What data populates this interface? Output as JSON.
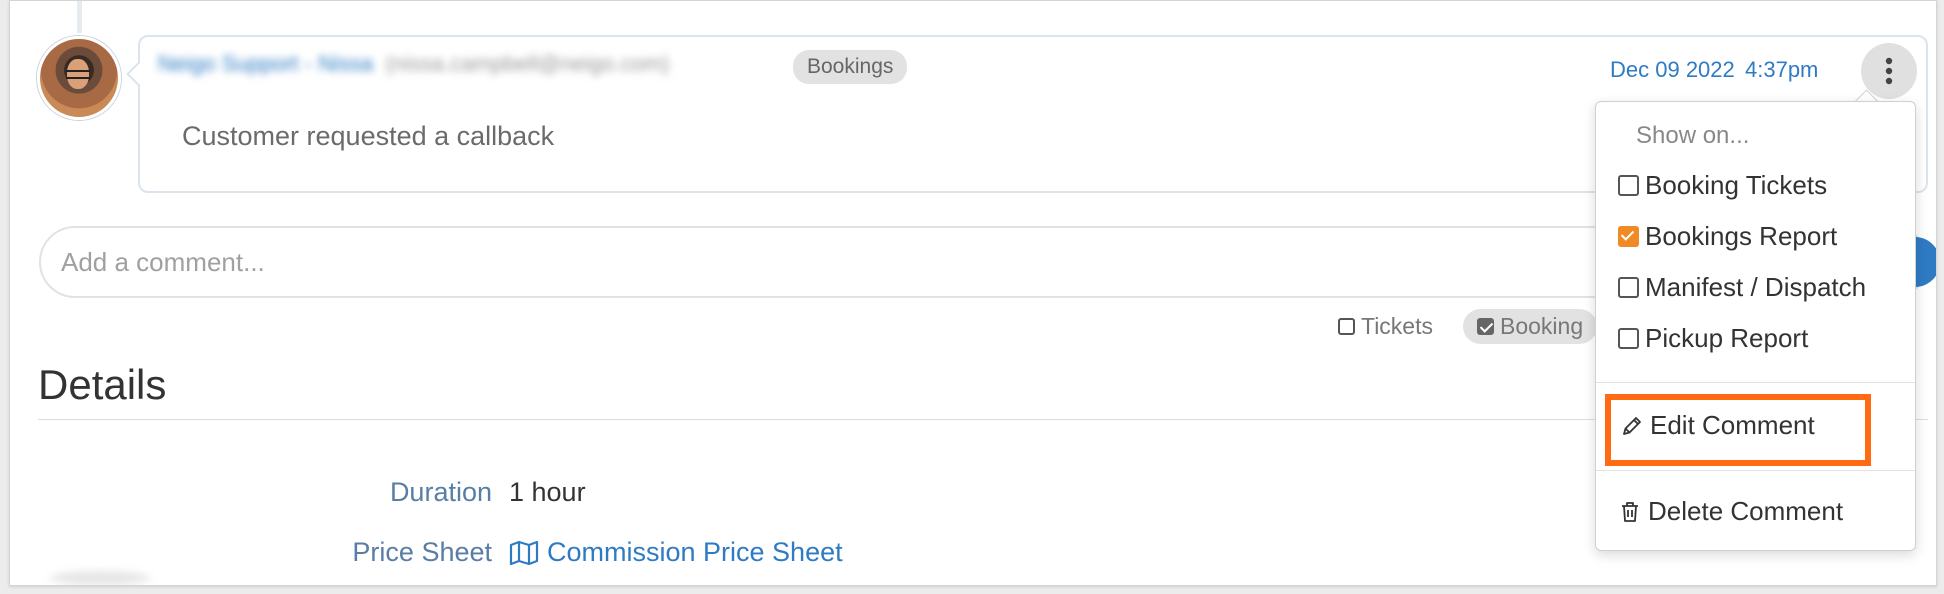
{
  "comment": {
    "author_name": "Neigo Support - Nissa",
    "author_email": "(nissa.campbell@neigo.com)",
    "badge": "Bookings",
    "text": "Customer requested a callback",
    "date": "Dec 09 2022",
    "time": "4:37pm"
  },
  "composer": {
    "placeholder": "Add a comment...",
    "options": [
      {
        "label": "Tickets",
        "checked": false
      },
      {
        "label": "Booking",
        "checked": true
      }
    ]
  },
  "details": {
    "title": "Details",
    "rows": [
      {
        "label": "Duration",
        "value": "1 hour"
      },
      {
        "label": "Price Sheet",
        "value": "Commission Price Sheet"
      }
    ]
  },
  "menu": {
    "header": "Show on...",
    "items": [
      {
        "label": "Booking Tickets",
        "checked": false
      },
      {
        "label": "Bookings Report",
        "checked": true
      },
      {
        "label": "Manifest / Dispatch",
        "checked": false
      },
      {
        "label": "Pickup Report",
        "checked": false
      }
    ],
    "edit_label": "Edit Comment",
    "delete_label": "Delete Comment"
  },
  "colors": {
    "accent": "#2e7bc4",
    "checked": "#f08a24",
    "highlight": "#ff6a13",
    "label": "#5a7da6"
  },
  "icons": {
    "more": "vertical-ellipsis-icon",
    "edit": "pencil-icon",
    "delete": "trash-icon",
    "price_sheet": "map-icon"
  }
}
